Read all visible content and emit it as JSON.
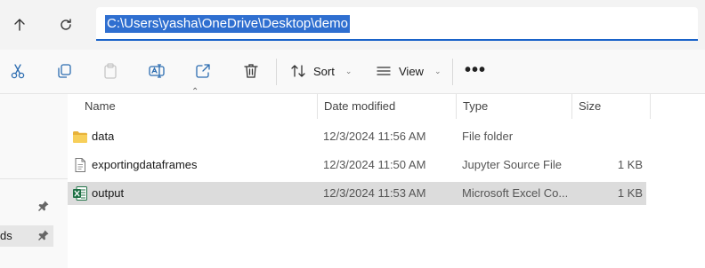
{
  "address_bar": {
    "path": "C:\\Users\\yasha\\OneDrive\\Desktop\\demo"
  },
  "toolbar": {
    "sort_label": "Sort",
    "view_label": "View",
    "more_label": "•••"
  },
  "columns": {
    "name": "Name",
    "date": "Date modified",
    "type": "Type",
    "size": "Size"
  },
  "files": [
    {
      "name": "data",
      "date": "12/3/2024 11:56 AM",
      "type": "File folder",
      "size": "",
      "icon": "folder-icon"
    },
    {
      "name": "exportingdataframes",
      "date": "12/3/2024 11:50 AM",
      "type": "Jupyter Source File",
      "size": "1 KB",
      "icon": "document-icon"
    },
    {
      "name": "output",
      "date": "12/3/2024 11:53 AM",
      "type": "Microsoft Excel Co...",
      "size": "1 KB",
      "icon": "excel-icon"
    }
  ],
  "left_pane": {
    "item_partial": "ds"
  },
  "colors": {
    "accent": "#1a63c9",
    "selection": "#2f6fd0",
    "folder": "#f1c24a",
    "excel": "#1d7044"
  }
}
